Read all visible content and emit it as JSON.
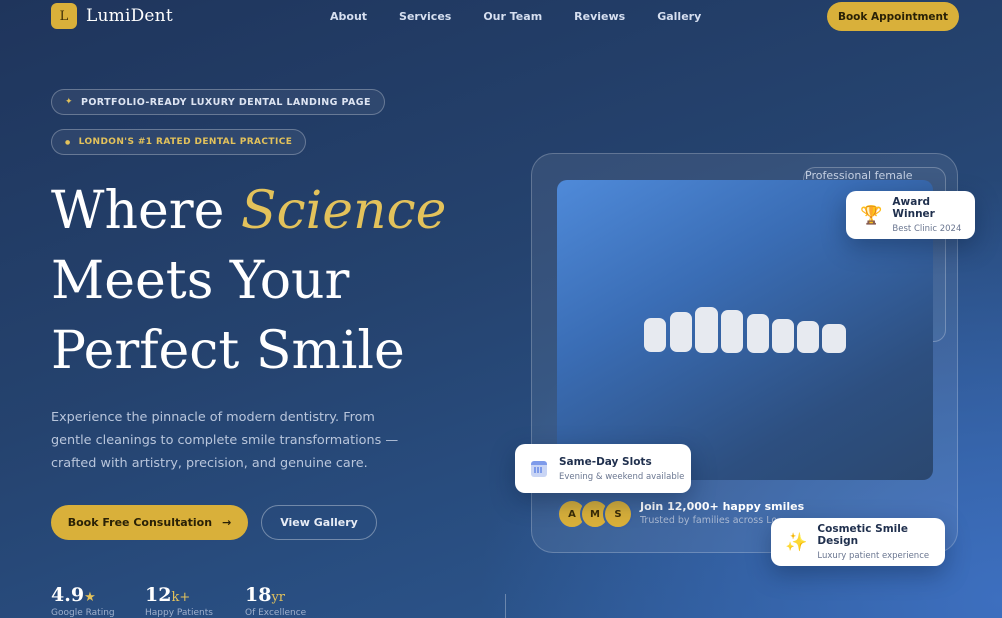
{
  "brand": {
    "mark": "L",
    "name": "LumiDent",
    "accent": "#d9b03a"
  },
  "nav": {
    "items": [
      "About",
      "Services",
      "Our Team",
      "Reviews",
      "Gallery"
    ],
    "cta": "Book Appointment"
  },
  "badges": [
    {
      "icon": "sparkle-icon",
      "glyph": "✦",
      "text": "PORTFOLIO-READY LUXURY DENTAL LANDING PAGE"
    },
    {
      "icon": "dot-icon",
      "glyph": "●",
      "text": "LONDON'S #1 RATED DENTAL PRACTICE"
    }
  ],
  "hero": {
    "line1_a": "Where ",
    "line1_accent": "Science",
    "line2": "Meets Your",
    "line3": "Perfect Smile",
    "description": "Experience the pinnacle of modern dentistry. From gentle cleanings to complete smile transformations — crafted with artistry, precision, and genuine care.",
    "primary_button": "Book Free Consultation",
    "primary_arrow": "→",
    "secondary_button": "View Gallery"
  },
  "stats": [
    {
      "num": "4.9",
      "suffix": "★",
      "label": "Google Rating"
    },
    {
      "num": "12",
      "suffix": "k+",
      "label": "Happy Patients"
    },
    {
      "num": "18",
      "suffix": "yr",
      "label": "Of Excellence"
    }
  ],
  "visual": {
    "image_alt": "Professional female",
    "avatars": [
      "A",
      "M",
      "S"
    ],
    "social_title": "Join 12,000+ happy smiles",
    "social_sub": "Trusted by families across London"
  },
  "floats": {
    "award": {
      "icon": "trophy-icon",
      "glyph": "🏆",
      "title": "Award Winner",
      "sub": "Best Clinic 2024"
    },
    "same_day": {
      "icon": "calendar-icon",
      "title": "Same-Day Slots",
      "sub": "Evening & weekend available"
    },
    "cosmetic": {
      "icon": "sparkles-icon",
      "glyph": "✨",
      "title": "Cosmetic Smile Design",
      "sub": "Luxury patient experience"
    }
  }
}
